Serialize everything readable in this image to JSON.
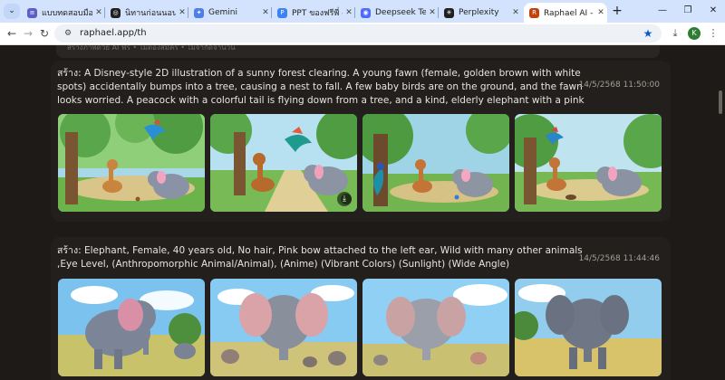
{
  "tabs": [
    {
      "title": "แบบทดสอบมืออาชีพ",
      "favicon_color": "#5b5fc7",
      "favicon": "≡",
      "active": false
    },
    {
      "title": "นิทานก่อนนอนของเด็ก",
      "favicon_color": "#202020",
      "favicon": "◎",
      "active": false
    },
    {
      "title": "Gemini",
      "favicon_color": "#4f7fe6",
      "favicon": "✦",
      "active": false
    },
    {
      "title": "PPT ของฟรีพี่ - แปล",
      "favicon_color": "#3b82f6",
      "favicon": "P",
      "active": false
    },
    {
      "title": "Deepseek Techno",
      "favicon_color": "#4d6bfe",
      "favicon": "◉",
      "active": false
    },
    {
      "title": "Perplexity",
      "favicon_color": "#202020",
      "favicon": "✳",
      "active": false
    },
    {
      "title": "Raphael AI - เครื่อง",
      "favicon_color": "#c2410c",
      "favicon": "R",
      "active": true
    }
  ],
  "browser": {
    "url": "raphael.app/th",
    "profile_initial": "K"
  },
  "icons": {
    "tab_menu": "chevron-down-icon",
    "new_tab": "plus-icon",
    "back": "arrow-left-icon",
    "forward": "arrow-right-icon",
    "reload": "reload-icon",
    "site_info": "tune-icon",
    "bookmark": "star-icon",
    "download": "download-icon"
  },
  "top_strip_text": "สร้างภาพด้วย AI ฟรี • ไม่ต้องสมัคร • ไม่จำกัดจำนวน",
  "generations": [
    {
      "prompt": "สร้าง: A Disney-style 2D illustration of a sunny forest clearing. A young fawn (female, golden brown with white spots) accidentally bumps into a tree, causing a nest to fall. A few baby birds are on the ground, and the fawn looks worried. A peacock with a colorful tail is flying down from a tree, and a kind, elderly elephant with a pink bow on her ear is walking in from the side. The light filters...",
      "timestamp": "14/5/2568 11:50:00",
      "images": [
        "forest-scene-1",
        "forest-scene-2",
        "forest-scene-3",
        "forest-scene-4"
      ]
    },
    {
      "prompt": "สร้าง: Elephant, Female, 40 years old, No hair, Pink bow attached to the left ear, Wild with many other animals ,Eye Level, (Anthropomorphic Animal/Animal), (Anime) (Vibrant Colors) (Sunlight) (Wide Angle)",
      "timestamp": "14/5/2568 11:44:46",
      "images": [
        "elephant-1",
        "elephant-2",
        "elephant-3",
        "elephant-4"
      ]
    }
  ],
  "colors": {
    "tab_strip": "#d3e3fd",
    "page_bg": "#1d1a18",
    "card_bg": "#221f1d",
    "accent": "#0b57d0"
  }
}
